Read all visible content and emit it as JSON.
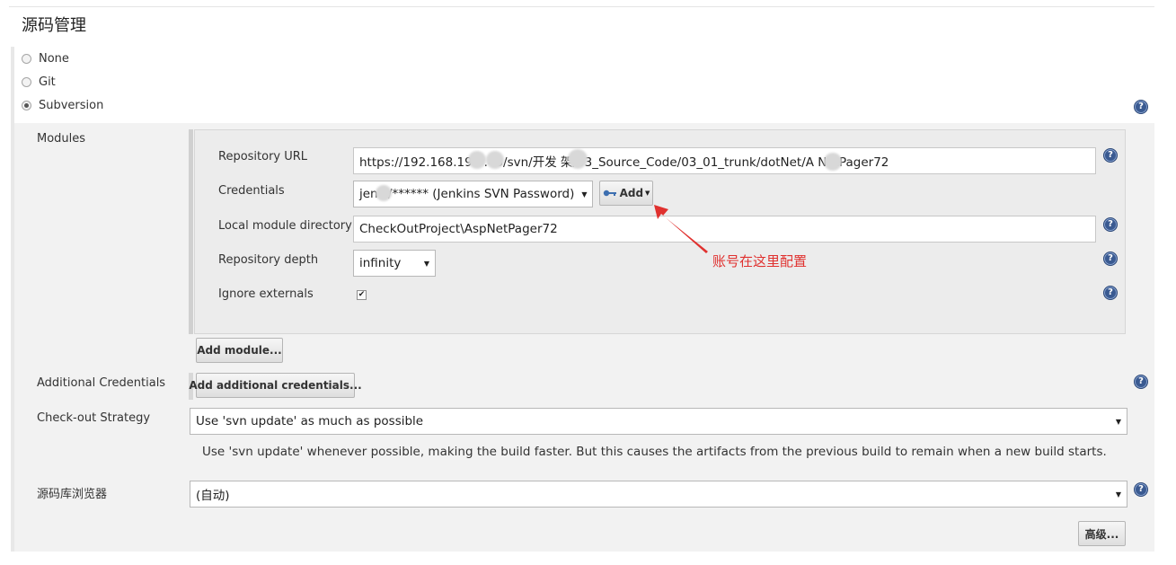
{
  "section": {
    "title": "源码管理"
  },
  "scm_options": [
    {
      "label": "None",
      "selected": false
    },
    {
      "label": "Git",
      "selected": false
    },
    {
      "label": "Subversion",
      "selected": true
    }
  ],
  "modules": {
    "label": "Modules",
    "repository_url": {
      "label": "Repository URL",
      "value": "https://192.168.199  .43/svn/开发  架/03_Source_Code/03_01_trunk/dotNet/A  NetPager72"
    },
    "credentials": {
      "label": "Credentials",
      "value": "jen  s/****** (Jenkins SVN Password)",
      "add_label": "Add"
    },
    "local_module_directory": {
      "label": "Local module directory",
      "value": "CheckOutProject\\AspNetPager72"
    },
    "repository_depth": {
      "label": "Repository depth",
      "value": "infinity"
    },
    "ignore_externals": {
      "label": "Ignore externals",
      "checked": true,
      "check_glyph": "✔"
    },
    "add_module_label": "Add module..."
  },
  "annotation": {
    "text": "账号在这里配置",
    "color": "#e0312f"
  },
  "additional_credentials": {
    "label": "Additional Credentials",
    "button_label": "Add additional credentials..."
  },
  "checkout_strategy": {
    "label": "Check-out Strategy",
    "value": "Use 'svn update' as much as possible",
    "description": "Use 'svn update' whenever possible, making the build faster. But this causes the artifacts from the previous build to remain when a new build starts."
  },
  "repo_browser": {
    "label": "源码库浏览器",
    "value": "(自动)"
  },
  "advanced_label": "高级...",
  "help_glyph": "?",
  "icons": {
    "help": "help-icon",
    "key": "key-icon",
    "dropdown": "chevron-down-icon",
    "arrow": "annotation-arrow"
  }
}
